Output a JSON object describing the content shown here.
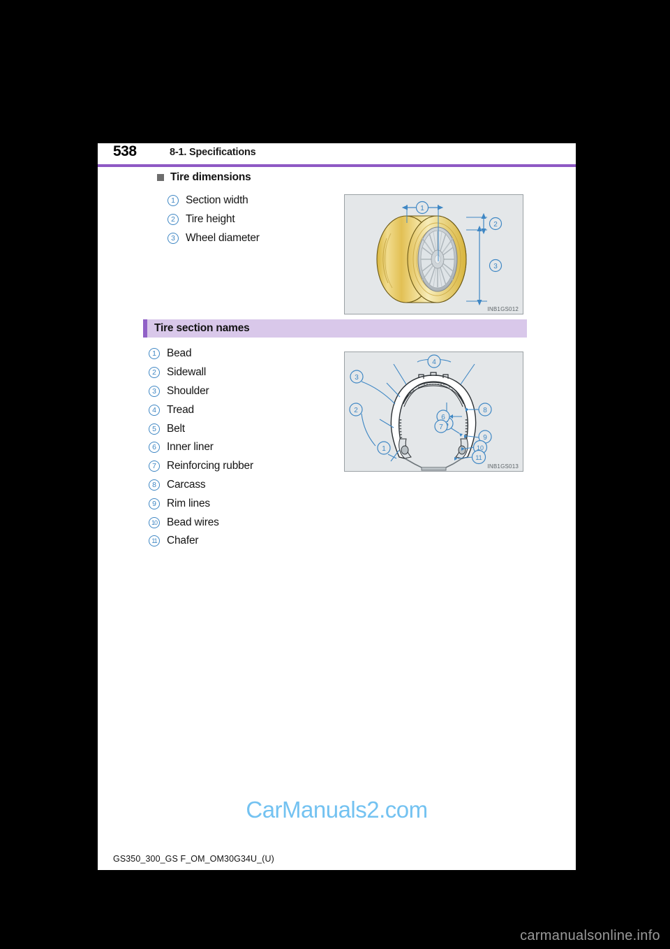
{
  "page": {
    "number": "538",
    "section": "8-1. Specifications",
    "footer_code": "GS350_300_GS F_OM_OM30G34U_(U)"
  },
  "colors": {
    "rule_purple": "#8e59c4",
    "bar_lavender": "#d9c8ea",
    "bar_accent": "#9161c7",
    "callout_blue": "#3f87c4",
    "figure_bg": "#e4e7e9",
    "tire_gold": "#e8c860",
    "watermark_blue": "#68bdf0"
  },
  "tire_dimensions": {
    "heading": "Tire dimensions",
    "items": [
      {
        "num": "1",
        "label": "Section width"
      },
      {
        "num": "2",
        "label": "Tire height"
      },
      {
        "num": "3",
        "label": "Wheel diameter"
      }
    ],
    "figure": {
      "code": "INB1GS012",
      "callouts": [
        "1",
        "2",
        "3"
      ]
    }
  },
  "tire_section_names": {
    "heading": "Tire section names",
    "items": [
      {
        "num": "1",
        "label": "Bead"
      },
      {
        "num": "2",
        "label": "Sidewall"
      },
      {
        "num": "3",
        "label": "Shoulder"
      },
      {
        "num": "4",
        "label": "Tread"
      },
      {
        "num": "5",
        "label": "Belt"
      },
      {
        "num": "6",
        "label": "Inner liner"
      },
      {
        "num": "7",
        "label": "Reinforcing rubber"
      },
      {
        "num": "8",
        "label": "Carcass"
      },
      {
        "num": "9",
        "label": "Rim lines"
      },
      {
        "num": "10",
        "label": "Bead wires"
      },
      {
        "num": "11",
        "label": "Chafer"
      }
    ],
    "figure": {
      "code": "INB1GS013",
      "callouts": [
        "1",
        "2",
        "3",
        "4",
        "5",
        "6",
        "7",
        "8",
        "9",
        "10",
        "11"
      ]
    }
  },
  "watermarks": {
    "center": "CarManuals2.com",
    "bottom_right": "carmanualsonline.info"
  }
}
